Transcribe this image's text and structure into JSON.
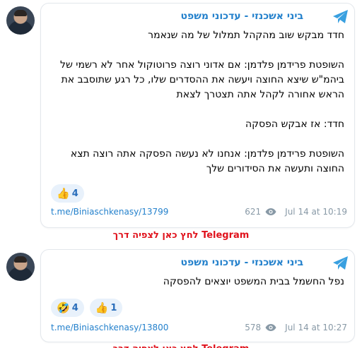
{
  "posts": [
    {
      "channel": "ביני אשכנזי - עדכוני משפט",
      "paragraphs": [
        "חדד מבקש שוב מהקהל תמלול של מה שנאמר",
        "השופטת פרידמן פלדמן: אם אדוני רוצה פרוטוקול אחר לא רשמי של ביהמ\"ש שיצא החוצה ויעשה את ההסדרים שלו, כל רגע שתוסבב את הראש אחורה לקהל אתה תצטרך לצאת",
        "חדד: אז אבקש הפסקה",
        "השופטת פרידמן פלדמן: אנחנו לא נעשה הפסקה אתה רוצה תצא החוצה ותעשה את הסידורים שלך"
      ],
      "reactions": [
        {
          "emoji": "👍",
          "count": "4"
        }
      ],
      "link": "t.me/Biniaschkenasy/13799",
      "views": "621",
      "date": "Jul 14 at 10:19"
    },
    {
      "channel": "ביני אשכנזי - עדכוני משפט",
      "paragraphs": [
        "נפל החשמל בבית המשפט יוצאים להפסקה"
      ],
      "reactions": [
        {
          "emoji": "🤣",
          "count": "4"
        },
        {
          "emoji": "👍",
          "count": "1"
        }
      ],
      "link": "t.me/Biniaschkenasy/13800",
      "views": "578",
      "date": "Jul 14 at 10:27"
    }
  ],
  "cta": "לחץ כאן לצפיה דרך Telegram",
  "colors": {
    "link": "#2481cc",
    "cta": "#e0121c",
    "reaction_bg": "#e8f1fb",
    "meta": "#8899a6"
  },
  "icons": {
    "channel": "telegram-plane-icon",
    "views": "eye-icon"
  }
}
